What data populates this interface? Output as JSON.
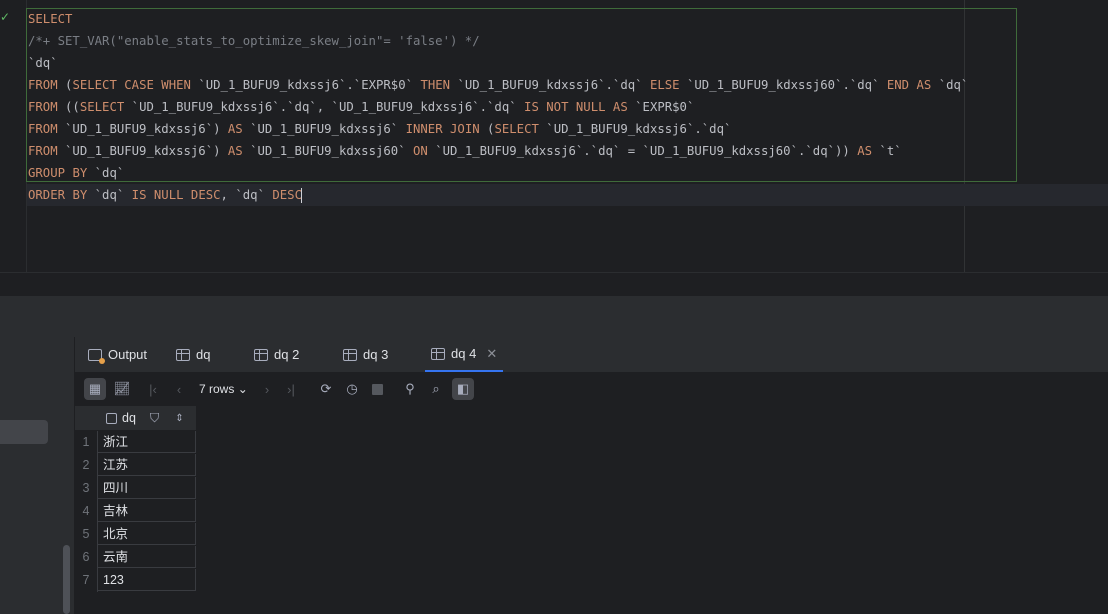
{
  "editor": {
    "lines": [
      "SELECT",
      "/*+ SET_VAR(\"enable_stats_to_optimize_skew_join\"= 'false') */",
      "`dq`",
      "FROM (SELECT CASE WHEN `UD_1_BUFU9_kdxssj6`.`EXPR$0` THEN `UD_1_BUFU9_kdxssj6`.`dq` ELSE `UD_1_BUFU9_kdxssj60`.`dq` END AS `dq`",
      "FROM ((SELECT `UD_1_BUFU9_kdxssj6`.`dq`, `UD_1_BUFU9_kdxssj6`.`dq` IS NOT NULL AS `EXPR$0`",
      "FROM `UD_1_BUFU9_kdxssj6`) AS `UD_1_BUFU9_kdxssj6` INNER JOIN (SELECT `UD_1_BUFU9_kdxssj6`.`dq`",
      "FROM `UD_1_BUFU9_kdxssj6`) AS `UD_1_BUFU9_kdxssj60` ON `UD_1_BUFU9_kdxssj6`.`dq` = `UD_1_BUFU9_kdxssj60`.`dq`)) AS `t`",
      "GROUP BY `dq`",
      "ORDER BY `dq` IS NULL DESC, `dq` DESC"
    ]
  },
  "tabs": [
    {
      "label": "Output",
      "icon": "output-icon"
    },
    {
      "label": "dq",
      "icon": "table-icon"
    },
    {
      "label": "dq 2",
      "icon": "table-icon"
    },
    {
      "label": "dq 3",
      "icon": "table-icon"
    },
    {
      "label": "dq 4",
      "icon": "table-icon",
      "active": true
    }
  ],
  "toolbar": {
    "rows_label": "7 rows"
  },
  "grid": {
    "column": "dq",
    "rows": [
      {
        "num": "1",
        "value": "浙江"
      },
      {
        "num": "2",
        "value": "江苏"
      },
      {
        "num": "3",
        "value": "四川"
      },
      {
        "num": "4",
        "value": "吉林"
      },
      {
        "num": "5",
        "value": "北京"
      },
      {
        "num": "6",
        "value": "云南"
      },
      {
        "num": "7",
        "value": "123"
      }
    ]
  },
  "colors": {
    "keyword": "#cf8e6d",
    "identifier": "#c77dbb",
    "comment": "#7a7e85",
    "accent": "#3574f0"
  }
}
